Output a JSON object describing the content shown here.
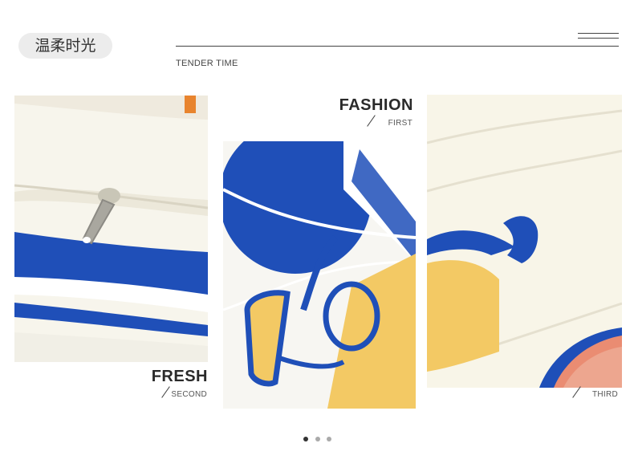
{
  "header": {
    "badge_text": "温柔时光",
    "subtitle": "TENDER TIME",
    "menu_icon": "hamburger-icon"
  },
  "gallery": [
    {
      "title": "FRESH",
      "sub": "SECOND"
    },
    {
      "title": "FASHION",
      "sub": "FIRST"
    },
    {
      "title": "",
      "sub": "THIRD"
    }
  ],
  "carousel": {
    "count": 3,
    "active_index": 0
  },
  "colors": {
    "accent_blue": "#1f4fb8",
    "accent_yellow": "#f3c964",
    "cream": "#f8f5e8",
    "coral": "#ea8c72"
  }
}
